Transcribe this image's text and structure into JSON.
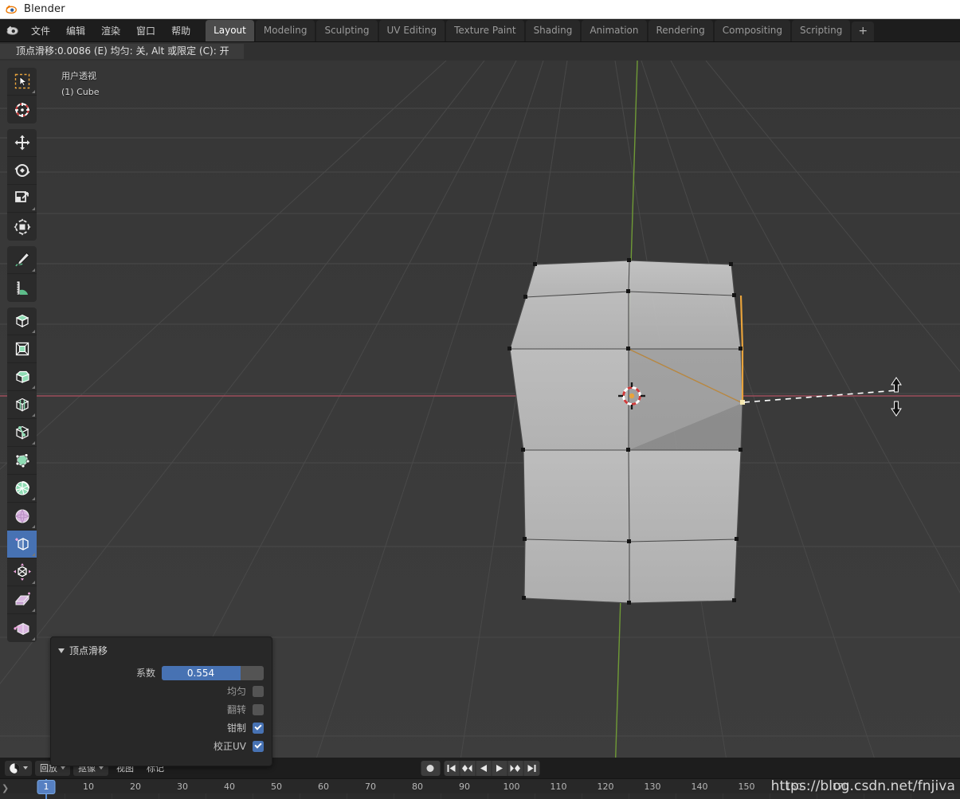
{
  "window": {
    "title": "Blender",
    "logo_icon": "blender-logo-icon"
  },
  "topbar": {
    "logo_icon": "blender-logo-icon",
    "menus": [
      "文件",
      "编辑",
      "渲染",
      "窗口",
      "帮助"
    ],
    "tabs": [
      {
        "label": "Layout",
        "active": true
      },
      {
        "label": "Modeling",
        "active": false
      },
      {
        "label": "Sculpting",
        "active": false
      },
      {
        "label": "UV Editing",
        "active": false
      },
      {
        "label": "Texture Paint",
        "active": false
      },
      {
        "label": "Shading",
        "active": false
      },
      {
        "label": "Animation",
        "active": false
      },
      {
        "label": "Rendering",
        "active": false
      },
      {
        "label": "Compositing",
        "active": false
      },
      {
        "label": "Scripting",
        "active": false
      }
    ],
    "add_tab_label": "+"
  },
  "status": {
    "text": "顶点滑移:0.0086 (E) 均匀: 关, Alt 或限定 (C): 开"
  },
  "viewport": {
    "view_name": "用户透视",
    "object_name": "(1) Cube",
    "bg_color": "#3a3a3a",
    "x_axis_color": "#9d4c5a",
    "y_axis_color": "#7c9c3a",
    "selected_edge_color": "#e5a13a",
    "cursor_icon": "move-vertical-cursor-icon"
  },
  "toolbar": {
    "groups": [
      {
        "tools": [
          {
            "name": "tweak-tool",
            "icon": "cursor-arrow-icon",
            "active": false,
            "has_submenu": true
          },
          {
            "name": "cursor-tool",
            "icon": "3d-cursor-icon",
            "active": false,
            "has_submenu": false
          }
        ]
      },
      {
        "tools": [
          {
            "name": "move-tool",
            "icon": "move-arrows-icon",
            "active": false,
            "has_submenu": false
          },
          {
            "name": "rotate-tool",
            "icon": "rotate-icon",
            "active": false,
            "has_submenu": false
          },
          {
            "name": "scale-tool",
            "icon": "scale-icon",
            "active": false,
            "has_submenu": true
          },
          {
            "name": "transform-tool",
            "icon": "transform-icon",
            "active": false,
            "has_submenu": false
          }
        ]
      },
      {
        "tools": [
          {
            "name": "annotate-tool",
            "icon": "pencil-icon",
            "active": false,
            "has_submenu": true
          },
          {
            "name": "measure-tool",
            "icon": "ruler-icon",
            "active": false,
            "has_submenu": false
          }
        ]
      },
      {
        "tools": [
          {
            "name": "extrude-region-tool",
            "icon": "extrude-cube-icon",
            "active": false,
            "has_submenu": true
          },
          {
            "name": "inset-faces-tool",
            "icon": "inset-faces-icon",
            "active": false,
            "has_submenu": false
          },
          {
            "name": "bevel-tool",
            "icon": "bevel-cube-icon",
            "active": false,
            "has_submenu": true
          },
          {
            "name": "loop-cut-tool",
            "icon": "loop-cut-icon",
            "active": false,
            "has_submenu": true
          },
          {
            "name": "knife-tool",
            "icon": "knife-icon",
            "active": false,
            "has_submenu": true
          },
          {
            "name": "poly-build-tool",
            "icon": "poly-build-icon",
            "active": false,
            "has_submenu": false
          },
          {
            "name": "spin-tool",
            "icon": "spin-icon",
            "active": false,
            "has_submenu": true
          },
          {
            "name": "smooth-tool",
            "icon": "smooth-sphere-icon",
            "active": false,
            "has_submenu": true
          },
          {
            "name": "edge-slide-tool",
            "icon": "edge-slide-icon",
            "active": true,
            "has_submenu": true
          },
          {
            "name": "shrink-fatten-tool",
            "icon": "shrink-fatten-icon",
            "active": false,
            "has_submenu": true
          },
          {
            "name": "shear-tool",
            "icon": "shear-icon",
            "active": false,
            "has_submenu": true
          },
          {
            "name": "rip-region-tool",
            "icon": "rip-region-icon",
            "active": false,
            "has_submenu": true
          }
        ]
      }
    ]
  },
  "operator_panel": {
    "title": "顶点滑移",
    "collapse_icon": "triangle-down-icon",
    "factor": {
      "label": "系数",
      "value": "0.554",
      "fill_percent": 77
    },
    "checkboxes": [
      {
        "label": "均匀",
        "checked": false
      },
      {
        "label": "翻转",
        "checked": false
      },
      {
        "label": "钳制",
        "checked": true
      },
      {
        "label": "校正UV",
        "checked": true
      }
    ]
  },
  "timeline": {
    "editor_icon": "timeline-editor-icon",
    "menus": [
      {
        "label": "回放",
        "has_chevron": true
      },
      {
        "label": "抠像",
        "has_chevron": true
      },
      {
        "label": "视图",
        "has_chevron": false
      },
      {
        "label": "标记",
        "has_chevron": false
      }
    ],
    "playback": [
      {
        "name": "record-button",
        "icon": "record-dot-icon"
      },
      {
        "name": "jump-to-start-button",
        "icon": "jump-start-icon"
      },
      {
        "name": "jump-to-prev-keyframe-button",
        "icon": "prev-keyframe-icon"
      },
      {
        "name": "play-reverse-button",
        "icon": "play-reverse-icon"
      },
      {
        "name": "play-button",
        "icon": "play-icon"
      },
      {
        "name": "jump-to-next-keyframe-button",
        "icon": "next-keyframe-icon"
      },
      {
        "name": "jump-to-end-button",
        "icon": "jump-end-icon"
      }
    ],
    "current_frame": "1",
    "ruler_ticks": [
      "10",
      "20",
      "30",
      "40",
      "50",
      "60",
      "70",
      "80",
      "90",
      "100",
      "110",
      "120",
      "130",
      "140",
      "150",
      "160",
      "170"
    ],
    "expand_icon": "chevron-right-icon"
  },
  "watermark": {
    "text": "https://blog.csdn.net/fnjiva"
  }
}
